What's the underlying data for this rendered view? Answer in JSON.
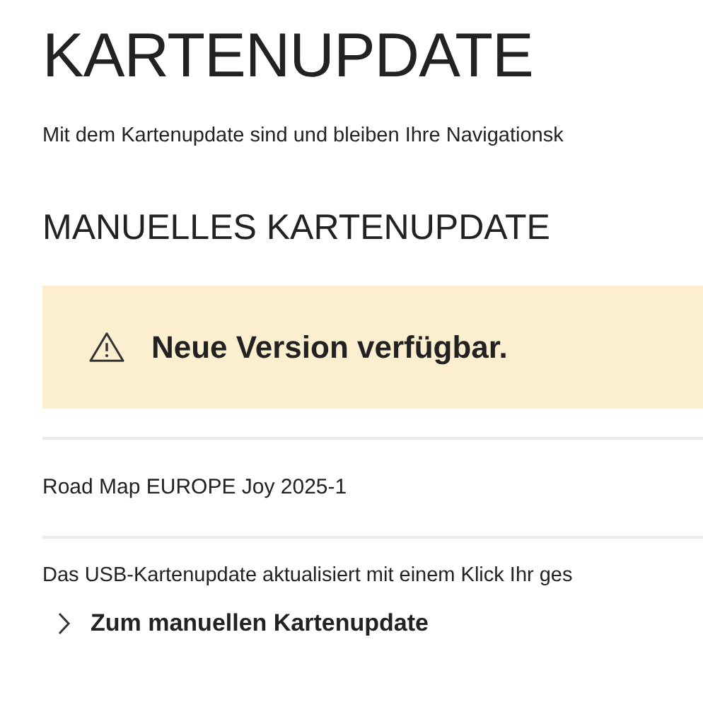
{
  "title": "KARTENUPDATE",
  "intro": "Mit dem Kartenupdate sind und bleiben Ihre Navigationsk",
  "section_heading": "MANUELLES KARTENUPDATE",
  "notice": {
    "kind": "warning",
    "text": "Neue Version verfügbar."
  },
  "version": "Road Map EUROPE Joy 2025-1",
  "description": "Das USB-Kartenupdate aktualisiert mit einem Klick Ihr ges",
  "link": "Zum manuellen Kartenupdate"
}
